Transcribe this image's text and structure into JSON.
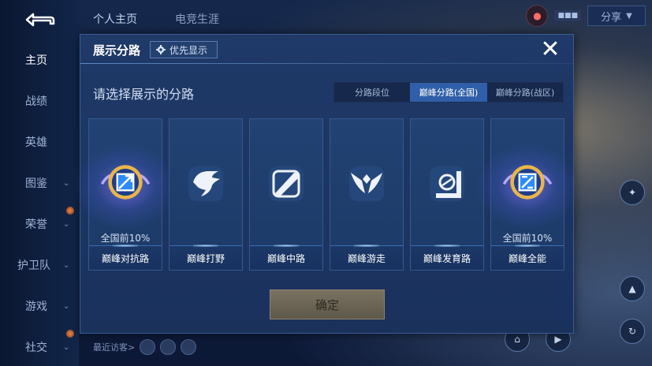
{
  "sidebar": {
    "items": [
      {
        "label": "主页",
        "chevron": false,
        "active": true
      },
      {
        "label": "战绩",
        "chevron": true
      },
      {
        "label": "英雄",
        "chevron": true
      },
      {
        "label": "图鉴",
        "chevron": true
      },
      {
        "label": "荣誉",
        "chevron": true
      },
      {
        "label": "护卫队",
        "chevron": true
      },
      {
        "label": "游戏",
        "chevron": true
      },
      {
        "label": "社交",
        "chevron": true
      }
    ]
  },
  "top_tabs": [
    "个人主页",
    "电竞生涯"
  ],
  "top_right": {
    "share_label": "分享"
  },
  "bottom": {
    "recent_visitors_label": "最近访客>"
  },
  "dialog": {
    "title": "展示分路",
    "priority_button": "优先显示",
    "subtitle": "请选择展示的分路",
    "tabs": [
      {
        "label": "分路段位",
        "active": false
      },
      {
        "label": "巅峰分路(全国)",
        "active": true
      },
      {
        "label": "巅峰分路(战区)",
        "active": false
      }
    ],
    "cards": [
      {
        "label": "巅峰对抗路",
        "rank": "全国前10%",
        "icon": "top-lane-badge-icon",
        "highlighted": true
      },
      {
        "label": "巅峰打野",
        "rank": "",
        "icon": "jungle-dragon-icon",
        "highlighted": false
      },
      {
        "label": "巅峰中路",
        "rank": "",
        "icon": "mid-lane-icon",
        "highlighted": false
      },
      {
        "label": "巅峰游走",
        "rank": "",
        "icon": "support-wings-icon",
        "highlighted": false
      },
      {
        "label": "巅峰发育路",
        "rank": "",
        "icon": "bot-lane-icon",
        "highlighted": false
      },
      {
        "label": "巅峰全能",
        "rank": "全国前10%",
        "icon": "all-round-badge-icon",
        "highlighted": true
      }
    ],
    "confirm_label": "确定",
    "colors": {
      "active_tab": "#2f5fa8",
      "confirm": "#6e6755",
      "badge_gold": "#e8b64a",
      "badge_blue": "#2c8bff"
    }
  }
}
